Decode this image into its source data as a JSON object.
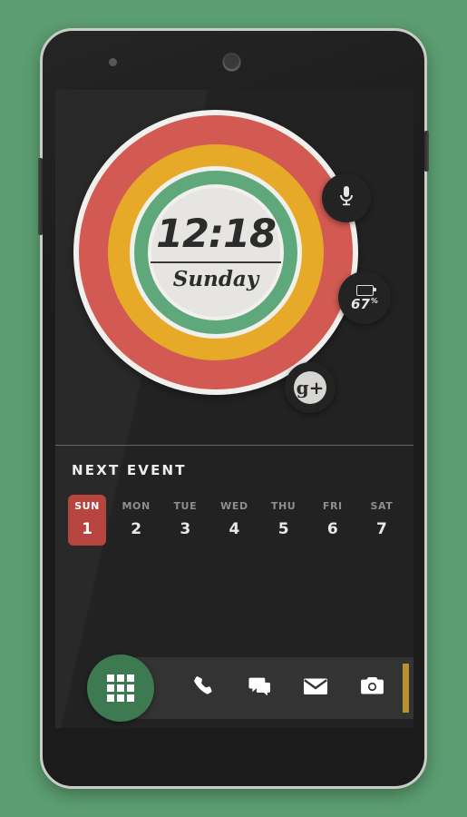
{
  "wallpaper": {
    "background_color": "#5c9e71"
  },
  "device": {
    "name": "android-phone",
    "frame_color": "#c9cdc6",
    "body_color": "#1b1b1b",
    "buttons": {
      "volume_rocker": "volume-rocker",
      "power": "power-button"
    },
    "sensors": {
      "proximity": "proximity-sensor",
      "front_camera": "front-camera"
    }
  },
  "clock_widget": {
    "time": "12:18",
    "day": "Sunday",
    "ring_colors": {
      "outer_white": "#f2f0ec",
      "red": "#d25a52",
      "yellow": "#e6a928",
      "green": "#5fa87c",
      "face": "#e6e5e1"
    }
  },
  "shortcuts": [
    {
      "name": "voice-search",
      "icon": "microphone-icon",
      "label": ""
    },
    {
      "name": "battery-status",
      "icon": "battery-icon",
      "value": "67",
      "unit": "%"
    },
    {
      "name": "google-plus",
      "icon": "google-plus-icon",
      "label": "g+"
    }
  ],
  "next_event": {
    "title": "NEXT EVENT",
    "days": [
      {
        "dow": "SUN",
        "num": "1",
        "today": true
      },
      {
        "dow": "MON",
        "num": "2",
        "today": false
      },
      {
        "dow": "TUE",
        "num": "3",
        "today": false
      },
      {
        "dow": "WED",
        "num": "4",
        "today": false
      },
      {
        "dow": "THU",
        "num": "5",
        "today": false
      },
      {
        "dow": "FRI",
        "num": "6",
        "today": false
      },
      {
        "dow": "SAT",
        "num": "7",
        "today": false
      }
    ],
    "highlight_color": "#b8443f"
  },
  "dock": {
    "background_color": "#333333",
    "accent_bar_color": "#b8922e",
    "app_drawer": {
      "name": "app-drawer",
      "color": "#3d7a51",
      "icon": "grid-icon"
    },
    "items": [
      {
        "name": "phone",
        "icon": "phone-icon"
      },
      {
        "name": "messages",
        "icon": "chat-bubble-icon"
      },
      {
        "name": "email",
        "icon": "envelope-icon"
      },
      {
        "name": "camera",
        "icon": "camera-icon"
      }
    ]
  }
}
